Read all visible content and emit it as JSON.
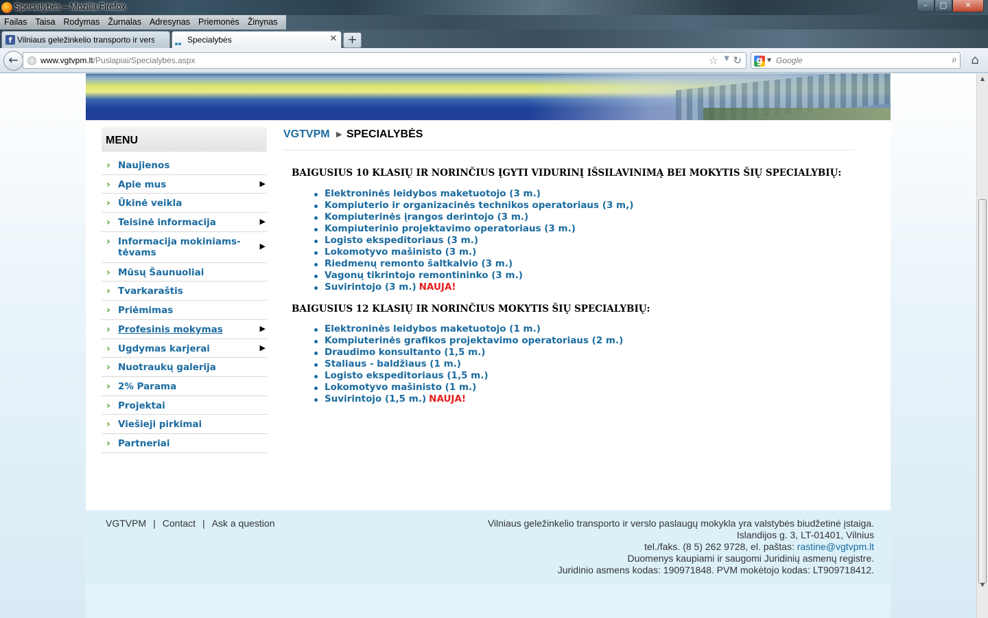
{
  "window": {
    "title": "Specialybės – Mozilla Firefox",
    "menu": [
      "Failas",
      "Taisa",
      "Rodymas",
      "Žurnalas",
      "Adresynas",
      "Priemonės",
      "Žinynas"
    ]
  },
  "tabs": [
    {
      "label": "Vilniaus geležinkelio transporto ir vers...",
      "active": false
    },
    {
      "label": "Specialybės",
      "active": true
    }
  ],
  "navbar": {
    "url_domain": "www.vgtvpm.lt",
    "url_path": "/Puslapiai/Specialybės.aspx",
    "search_placeholder": "Google"
  },
  "sidebar": {
    "heading": "MENU",
    "items": [
      {
        "label": "Naujienos",
        "submenu": false
      },
      {
        "label": "Apie mus",
        "submenu": true
      },
      {
        "label": "Ūkinė veikla",
        "submenu": false
      },
      {
        "label": "Teisinė informacija",
        "submenu": true
      },
      {
        "label": "Informacija mokiniams-tėvams",
        "submenu": true
      },
      {
        "label": "Mūsų Šaunuoliai",
        "submenu": false
      },
      {
        "label": "Tvarkaraštis",
        "submenu": false
      },
      {
        "label": "Priėmimas",
        "submenu": false
      },
      {
        "label": "Profesinis mokymas",
        "submenu": true
      },
      {
        "label": "Ugdymas karjerai",
        "submenu": true
      },
      {
        "label": "Nuotraukų galerija",
        "submenu": false
      },
      {
        "label": "2% Parama",
        "submenu": false
      },
      {
        "label": "Projektai",
        "submenu": false
      },
      {
        "label": "Viešieji pirkimai",
        "submenu": false
      },
      {
        "label": "Partneriai",
        "submenu": false
      }
    ]
  },
  "breadcrumb": {
    "home": "VGTVPM",
    "current": "SPECIALYBĖS"
  },
  "sections": [
    {
      "title": "BAIGUSIUS 10 KLASIŲ IR NORINČIUS ĮGYTI VIDURINĮ IŠSILAVINIMĄ BEI MOKYTIS ŠIŲ SPECIALYBIŲ:",
      "items": [
        {
          "label": "Elektroninės leidybos maketuotojo (3 m.)",
          "badge": ""
        },
        {
          "label": "Kompiuterio ir organizacinės technikos operatoriaus (3 m,)",
          "badge": ""
        },
        {
          "label": "Kompiuterinės įrangos derintojo (3 m.)",
          "badge": ""
        },
        {
          "label": "Kompiuterinio projektavimo operatoriaus (3 m.)",
          "badge": ""
        },
        {
          "label": "Logisto ekspeditoriaus (3 m.)",
          "badge": ""
        },
        {
          "label": "Lokomotyvo mašinisto (3 m.)",
          "badge": ""
        },
        {
          "label": "Riedmenų remonto šaltkalvio (3 m.)",
          "badge": ""
        },
        {
          "label": "Vagonų tikrintojo remontininko (3 m.)",
          "badge": ""
        },
        {
          "label": "Suvirintojo (3 m.)",
          "badge": "NAUJA!"
        }
      ]
    },
    {
      "title": "BAIGUSIUS 12 KLASIŲ IR NORINČIUS MOKYTIS ŠIŲ SPECIALYBIŲ:",
      "items": [
        {
          "label": "Elektroninės leidybos maketuotojo (1 m.)",
          "badge": ""
        },
        {
          "label": "Kompiuterinės grafikos projektavimo operatoriaus (2 m.)",
          "badge": ""
        },
        {
          "label": "Draudimo konsultanto (1,5 m.)",
          "badge": ""
        },
        {
          "label": "Staliaus - baldžiaus (1 m.)",
          "badge": ""
        },
        {
          "label": "Logisto ekspeditoriaus (1,5 m.)",
          "badge": ""
        },
        {
          "label": "Lokomotyvo mašinisto (1 m.)",
          "badge": ""
        },
        {
          "label": "Suvirintojo (1,5 m.)",
          "badge": "NAUJA!"
        }
      ]
    }
  ],
  "footer": {
    "links": [
      "VGTVPM",
      "Contact",
      "Ask a question"
    ],
    "info_line1": "Vilniaus geležinkelio transporto ir verslo paslaugų mokykla yra valstybės biudžetinė įstaiga.",
    "info_line2": "Islandijos g. 3, LT-01401, Vilnius",
    "info_line3_prefix": "tel./faks. (8 5) 262 9728, el. paštas:",
    "email": "rastine@vgtvpm.lt",
    "info_line4": "Duomenys kaupiami ir saugomi Juridinių asmenų registre.",
    "info_line5": "Juridinio asmens kodas: 190971848. PVM mokėtojo kodas: LT909718412."
  },
  "colors": {
    "link": "#1a6ba0",
    "badge": "#e81e1e",
    "bullet": "#5aa02c"
  }
}
